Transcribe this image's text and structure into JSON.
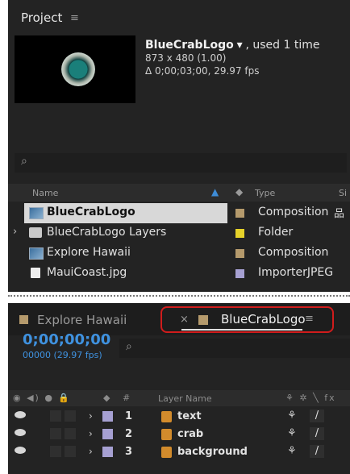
{
  "project": {
    "title": "Project",
    "menu_icon": "≡",
    "selected_item": {
      "name": "BlueCrabLogo",
      "dropdown": "▾",
      "usage": ", used 1 time",
      "size_line": "873 x 480 (1.00)",
      "duration_line": "Δ 0;00;03;00, 29.97 fps"
    },
    "search_icon": "⌕",
    "columns": {
      "name": "Name",
      "type": "Type",
      "size": "Si"
    },
    "items": [
      {
        "name": "BlueCrabLogo",
        "type": "Composition",
        "icon": "composition-icon",
        "label_color": "#b59a6c",
        "expander": "",
        "extra": "品"
      },
      {
        "name": "BlueCrabLogo Layers",
        "type": "Folder",
        "icon": "folder-icon",
        "label_color": "#e6d22a",
        "expander": "›",
        "extra": ""
      },
      {
        "name": "Explore Hawaii",
        "type": "Composition",
        "icon": "composition-icon",
        "label_color": "#b59a6c",
        "expander": "",
        "extra": ""
      },
      {
        "name": "MauiCoast.jpg",
        "type": "ImporterJPEG",
        "icon": "jpeg-file-icon",
        "label_color": "#a6a0d2",
        "expander": "",
        "extra": ""
      }
    ]
  },
  "timeline": {
    "tabs": [
      {
        "label": "Explore Hawaii",
        "color": "#b59a6c"
      },
      {
        "label": "BlueCrabLogo",
        "color": "#b59a6c",
        "close": "×",
        "menu": "≡"
      }
    ],
    "timecode": "0;00;00;00",
    "fps": "00000 (29.97 fps)",
    "search_icon": "⌕",
    "columns": {
      "switch_icons": "◉ ◀) ● 🔒",
      "label": "◆",
      "hash": "#",
      "layer_name": "Layer Name",
      "switches": "⚘ ✲ ╲ fx"
    },
    "layers": [
      {
        "num": "1",
        "name": "text",
        "expander": "›",
        "switch1": "⚘",
        "switch2": "/"
      },
      {
        "num": "2",
        "name": "crab",
        "expander": "›",
        "switch1": "⚘",
        "switch2": "/"
      },
      {
        "num": "3",
        "name": "background",
        "expander": "›",
        "switch1": "⚘",
        "switch2": "/"
      }
    ]
  },
  "colors": {
    "accent": "#3f92e0",
    "highlight": "#d01c1c",
    "panel": "#232323"
  }
}
